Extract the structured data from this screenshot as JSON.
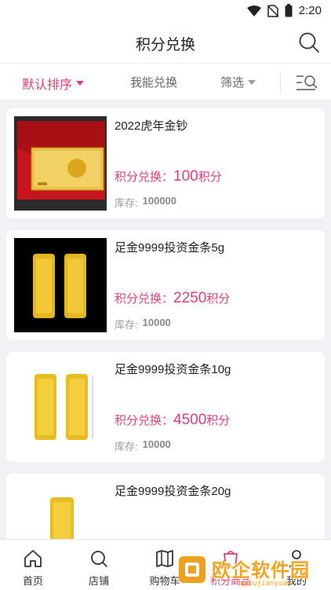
{
  "status_bar": {
    "time": "2:20",
    "icons": [
      "wifi-icon",
      "no-sim-icon",
      "battery-icon"
    ]
  },
  "header": {
    "title": "积分兑换",
    "search_icon": "search-icon"
  },
  "filters": {
    "sort": "默认排序",
    "exchangeable": "我能兑换",
    "screen": "筛选",
    "layout_icon": "list-layout-icon"
  },
  "products": [
    {
      "name": "2022虎年金钞",
      "price_label": "积分兑换：",
      "points": "100",
      "points_unit": "积分",
      "stock_label": "库存:",
      "stock": "100000"
    },
    {
      "name": "足金9999投资金条5g",
      "price_label": "积分兑换：",
      "points": "2250",
      "points_unit": "积分",
      "stock_label": "库存:",
      "stock": "10000"
    },
    {
      "name": "足金9999投资金条10g",
      "price_label": "积分兑换：",
      "points": "4500",
      "points_unit": "积分",
      "stock_label": "库存:",
      "stock": "10000"
    },
    {
      "name": "足金9999投资金条20g",
      "price_label": "",
      "points": "",
      "points_unit": "",
      "stock_label": "",
      "stock": ""
    }
  ],
  "tabbar": {
    "items": [
      {
        "label": "首页",
        "icon": "home-icon"
      },
      {
        "label": "店铺",
        "icon": "search-icon"
      },
      {
        "label": "购物车",
        "icon": "book-icon"
      },
      {
        "label": "积分商品",
        "icon": "points-icon",
        "active": true
      },
      {
        "label": "我的",
        "icon": "user-icon"
      }
    ]
  },
  "watermark": {
    "text": "欧企软件园",
    "url": "qpoujianyuan"
  },
  "colors": {
    "accent": "#e23d7a",
    "gold": "#d9a81e",
    "watermark": "#f3a422"
  }
}
